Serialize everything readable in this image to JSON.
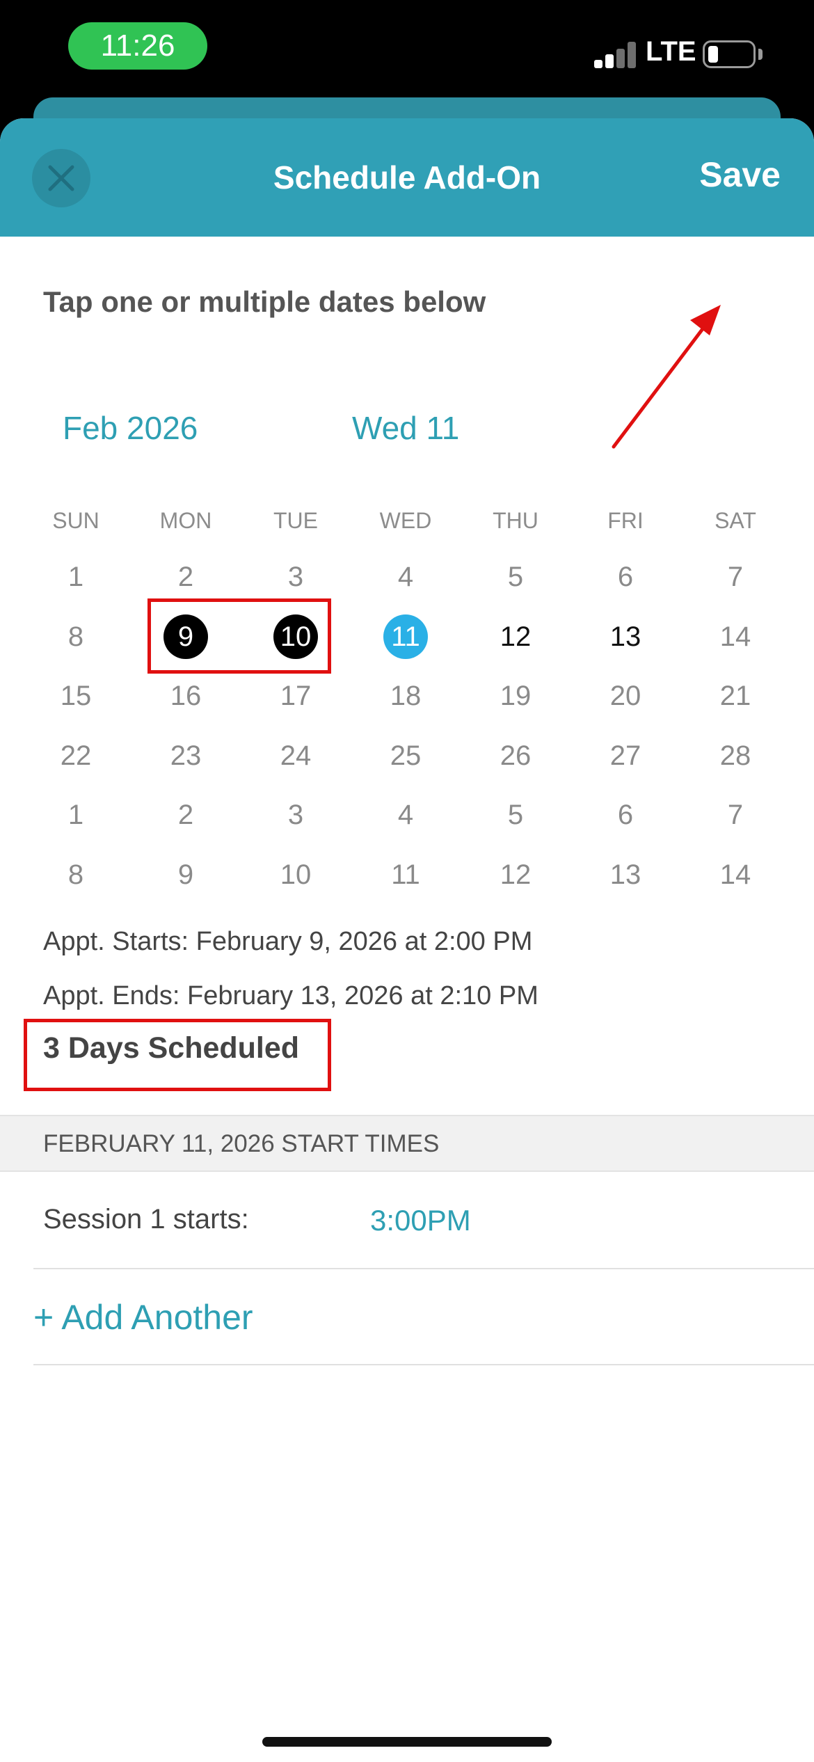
{
  "status_bar": {
    "time": "11:26",
    "network": "LTE",
    "signal_bars": 2,
    "battery_level": 0.2
  },
  "header": {
    "close_icon": "close-icon",
    "title": "Schedule Add-On",
    "save_label": "Save"
  },
  "instruction": "Tap one or multiple dates below",
  "calendar": {
    "month_label": "Feb 2026",
    "day_label": "Wed 11",
    "weekdays": [
      "SUN",
      "MON",
      "TUE",
      "WED",
      "THU",
      "FRI",
      "SAT"
    ],
    "weeks": [
      [
        "1",
        "2",
        "3",
        "4",
        "5",
        "6",
        "7"
      ],
      [
        "8",
        "9",
        "10",
        "11",
        "12",
        "13",
        "14"
      ],
      [
        "15",
        "16",
        "17",
        "18",
        "19",
        "20",
        "21"
      ],
      [
        "22",
        "23",
        "24",
        "25",
        "26",
        "27",
        "28"
      ],
      [
        "1",
        "2",
        "3",
        "4",
        "5",
        "6",
        "7"
      ],
      [
        "8",
        "9",
        "10",
        "11",
        "12",
        "13",
        "14"
      ]
    ],
    "selected_dates": [
      "9",
      "10"
    ],
    "today": "11",
    "scheduled_dates": [
      "12",
      "13"
    ],
    "colors": {
      "accent": "#2e9fb3",
      "today": "#2ab0e6",
      "selected": "#000000",
      "header": "#30a0b6"
    }
  },
  "appointment": {
    "starts": "Appt. Starts: February 9, 2026 at 2:00 PM",
    "ends": "Appt. Ends: February 13, 2026 at 2:10 PM",
    "days_scheduled": "3 Days Scheduled"
  },
  "start_times": {
    "section_title": "FEBRUARY 11, 2026 START TIMES",
    "sessions": [
      {
        "label": "Session 1 starts:",
        "time": "3:00PM"
      }
    ],
    "add_another": "+ Add Another"
  },
  "annotations": {
    "highlight_color": "#e01010"
  }
}
